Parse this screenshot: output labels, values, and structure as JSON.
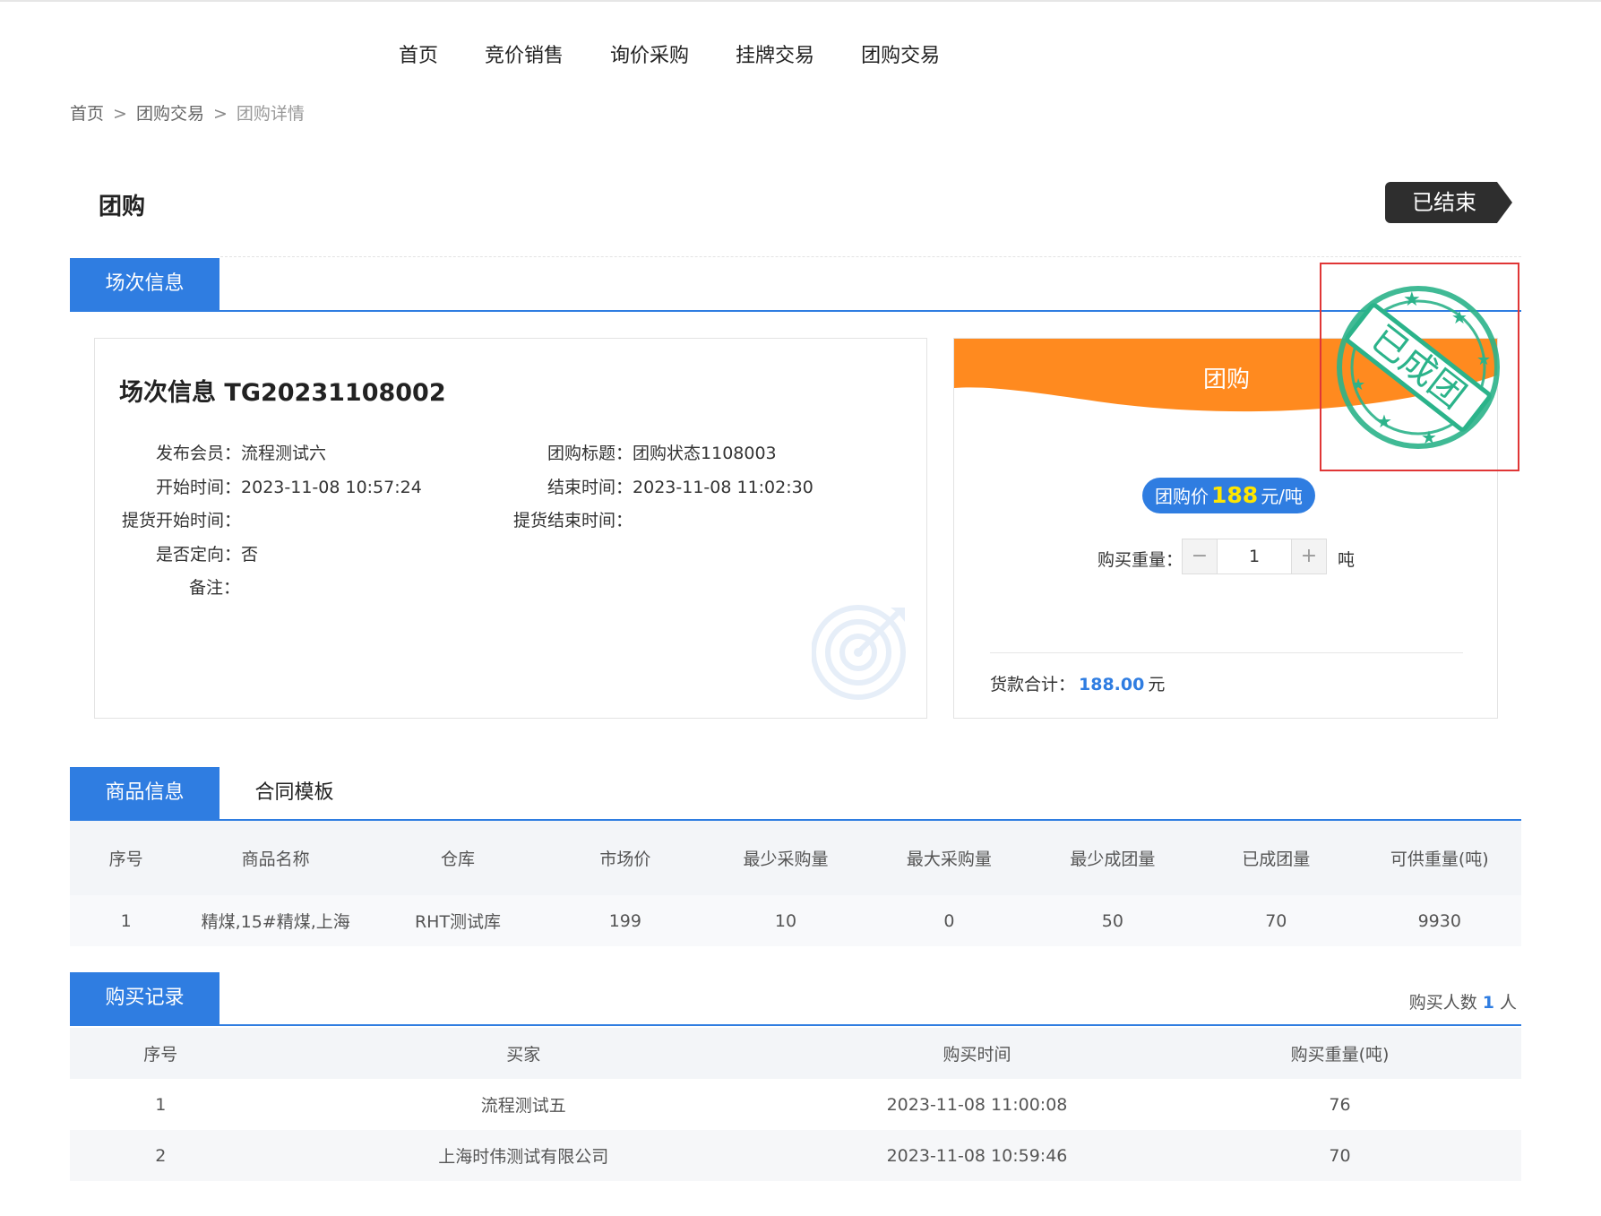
{
  "nav": [
    "首页",
    "竞价销售",
    "询价采购",
    "挂牌交易",
    "团购交易"
  ],
  "breadcrumb": {
    "home": "首页",
    "sep": ">",
    "parent": "团购交易",
    "current": "团购详情"
  },
  "page_title": "团购",
  "status_tag": "已结束",
  "tabs_session": {
    "active": "场次信息"
  },
  "session": {
    "title": "场次信息 TG20231108002",
    "publisher_label": "发布会员：",
    "publisher": "流程测试六",
    "group_title_label": "团购标题：",
    "group_title": "团购状态1108003",
    "start_label": "开始时间：",
    "start": "2023-11-08 10:57:24",
    "end_label": "结束时间：",
    "end": "2023-11-08 11:02:30",
    "pickup_start_label": "提货开始时间：",
    "pickup_start": "",
    "pickup_end_label": "提货结束时间：",
    "pickup_end": "",
    "directed_label": "是否定向：",
    "directed": "否",
    "remark_label": "备注：",
    "remark": ""
  },
  "buy": {
    "banner": "团购",
    "price_prefix": "团购价",
    "price": "188",
    "price_unit": "元/吨",
    "qty_label": "购买重量：",
    "minus": "−",
    "qty": "1",
    "plus": "+",
    "unit": "吨",
    "total_label": "货款合计：",
    "total": "188.00",
    "total_unit": "元"
  },
  "stamp": {
    "text": "已成团"
  },
  "tabs_goods": {
    "active": "商品信息",
    "other": "合同模板"
  },
  "goods": {
    "headers": [
      "序号",
      "商品名称",
      "仓库",
      "市场价",
      "最少采购量",
      "最大采购量",
      "最少成团量",
      "已成团量",
      "可供重量(吨)"
    ],
    "rows": [
      [
        "1",
        "精煤,15#精煤,上海",
        "RHT测试库",
        "199",
        "10",
        "0",
        "50",
        "70",
        "9930"
      ]
    ]
  },
  "tabs_records": {
    "active": "购买记录"
  },
  "records": {
    "buyers_label": "购买人数",
    "buyers_count": "1",
    "buyers_unit": "人",
    "headers": [
      "序号",
      "买家",
      "购买时间",
      "购买重量(吨)"
    ],
    "rows": [
      [
        "1",
        "流程测试五",
        "2023-11-08 11:00:08",
        "76"
      ],
      [
        "2",
        "上海时伟测试有限公司",
        "2023-11-08 10:59:46",
        "70"
      ]
    ]
  },
  "colors": {
    "primary": "#2f7de1",
    "orange": "#ff8a1f",
    "stamp_green": "#2bb38a",
    "stamp_box": "#e03636",
    "tag_dark": "#2e2e2e"
  }
}
